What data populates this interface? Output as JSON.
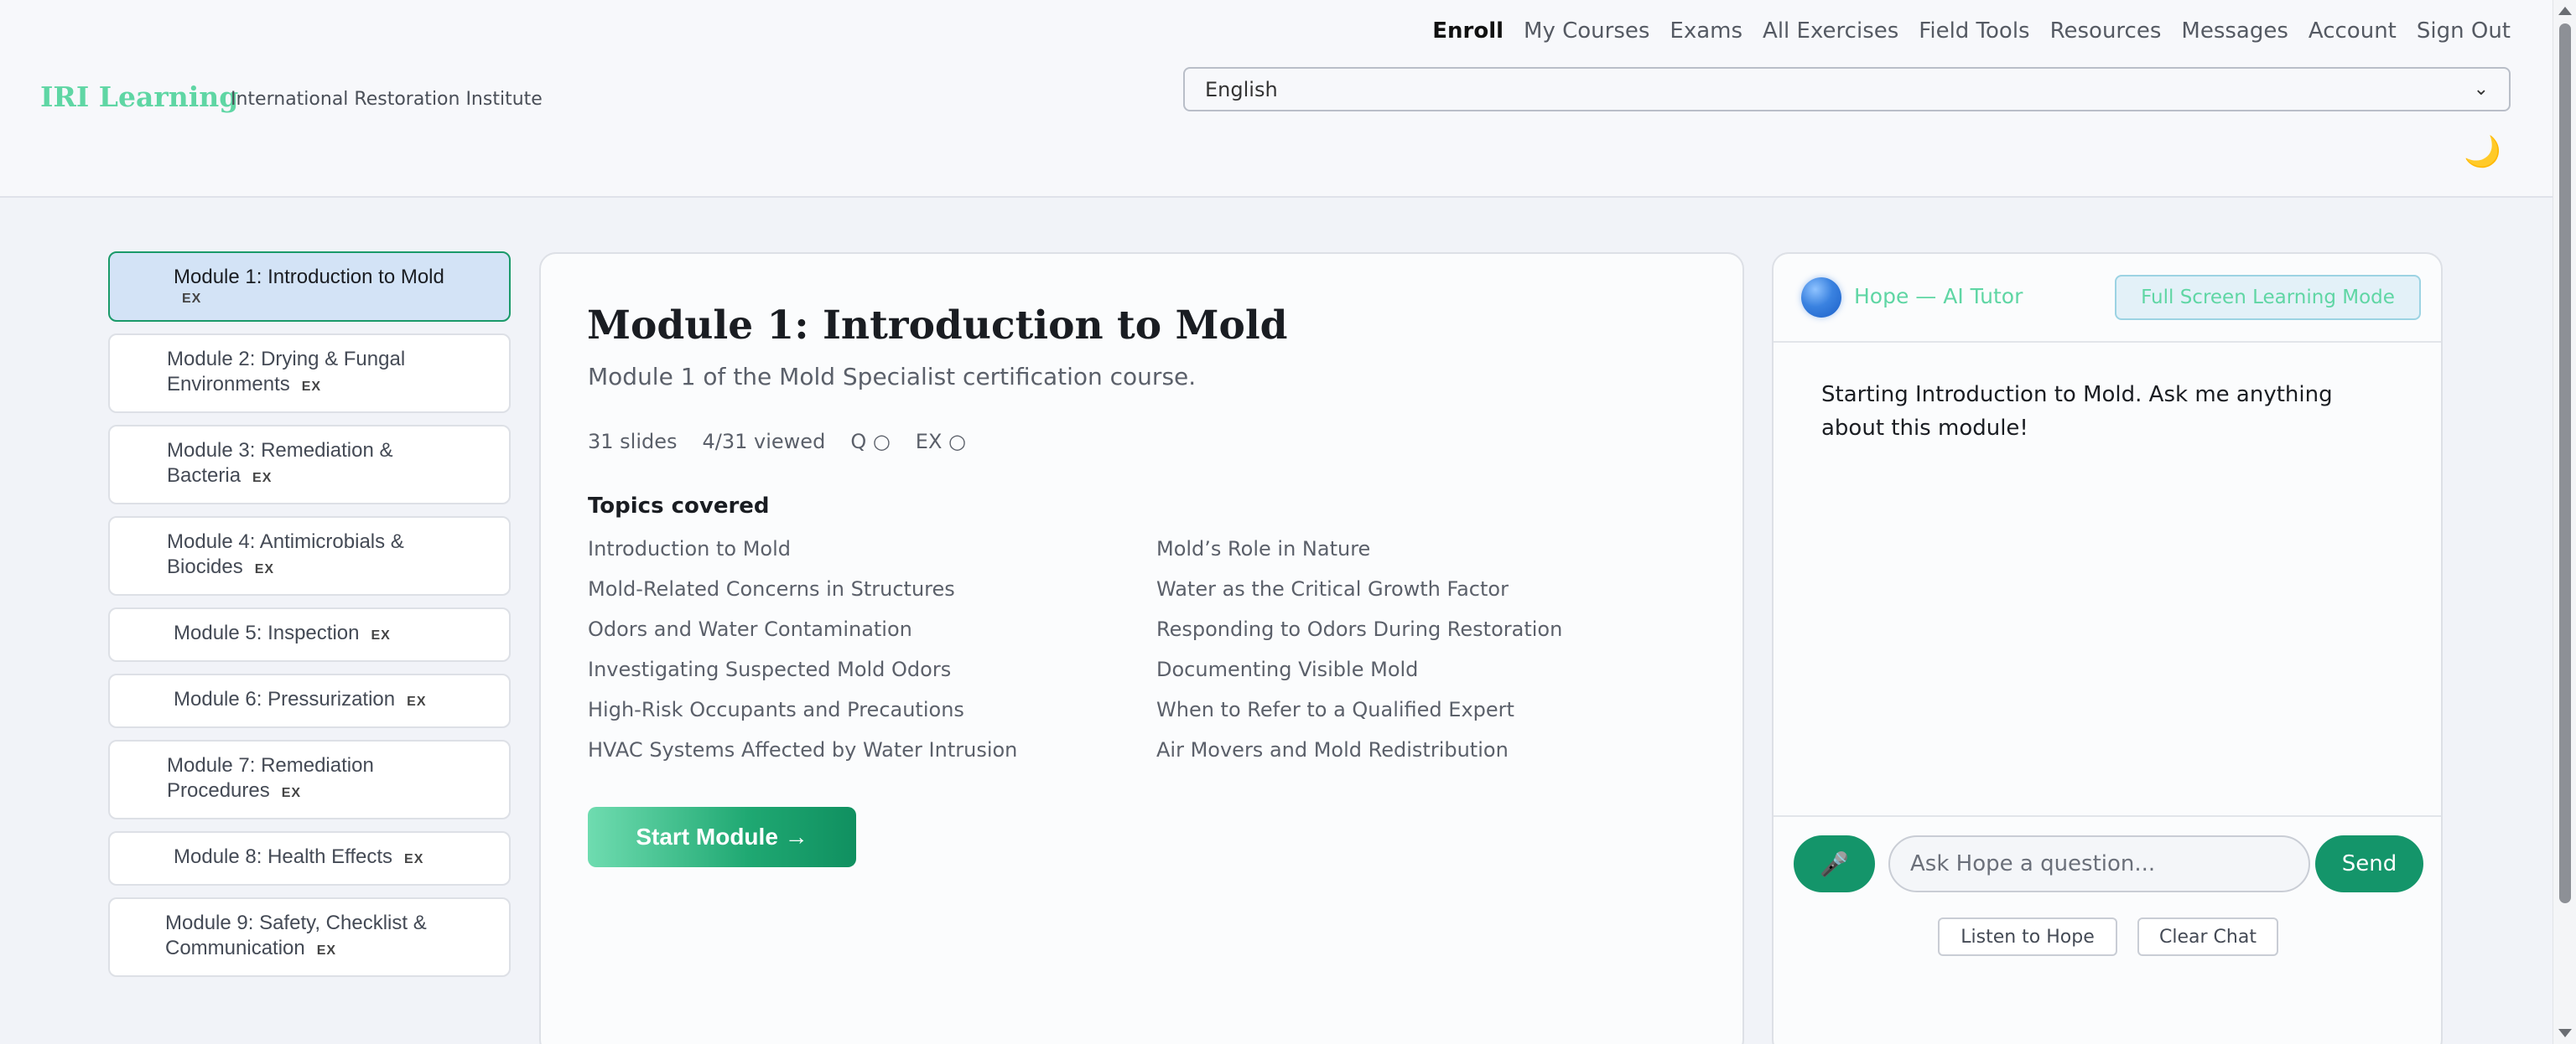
{
  "header": {
    "logo": "IRI Learning",
    "org_name": "International Restoration Institute",
    "nav": [
      "Enroll",
      "My Courses",
      "Exams",
      "All Exercises",
      "Field Tools",
      "Resources",
      "Messages",
      "Account",
      "Sign Out"
    ],
    "active_nav": "Enroll",
    "language": "English",
    "theme_icon": "moon-icon"
  },
  "modules": [
    {
      "title": "Module 1: Introduction to Mold",
      "tag": "EX",
      "active": true
    },
    {
      "title": "Module 2: Drying & Fungal Environments",
      "tag": "EX"
    },
    {
      "title": "Module 3: Remediation & Bacteria",
      "tag": "EX"
    },
    {
      "title": "Module 4: Antimicrobials & Biocides",
      "tag": "EX"
    },
    {
      "title": "Module 5: Inspection",
      "tag": "EX"
    },
    {
      "title": "Module 6: Pressurization",
      "tag": "EX"
    },
    {
      "title": "Module 7: Remediation Procedures",
      "tag": "EX"
    },
    {
      "title": "Module 8: Health Effects",
      "tag": "EX"
    },
    {
      "title": "Module 9: Safety, Checklist & Communication",
      "tag": "EX"
    }
  ],
  "main": {
    "title": "Module 1: Introduction to Mold",
    "subtitle": "Module 1 of the Mold Specialist certification course.",
    "stats": [
      "31 slides",
      "4/31 viewed",
      "Q ○",
      "EX ○"
    ],
    "topics_heading": "Topics covered",
    "topics": [
      "Introduction to Mold",
      "Mold’s Role in Nature",
      "Mold-Related Concerns in Structures",
      "Water as the Critical Growth Factor",
      "Odors and Water Contamination",
      "Responding to Odors During Restoration",
      "Investigating Suspected Mold Odors",
      "Documenting Visible Mold",
      "High-Risk Occupants and Precautions",
      "When to Refer to a Qualified Expert",
      "HVAC Systems Affected by Water Intrusion",
      "Air Movers and Mold Redistribution"
    ],
    "start_button": "Start Module →"
  },
  "tutor": {
    "name": "Hope — AI Tutor",
    "fullscreen_button": "Full Screen Learning Mode",
    "message": "Starting Introduction to Mold. Ask me anything about this module!",
    "input_placeholder": "Ask Hope a question...",
    "send_button": "Send",
    "mic_icon": "🎤",
    "listen_button": "Listen to Hope",
    "clear_button": "Clear Chat"
  },
  "colors": {
    "accent_green": "#14956a",
    "logo_mint": "#5fd6a4",
    "active_module_bg": "#d3e3f6"
  }
}
